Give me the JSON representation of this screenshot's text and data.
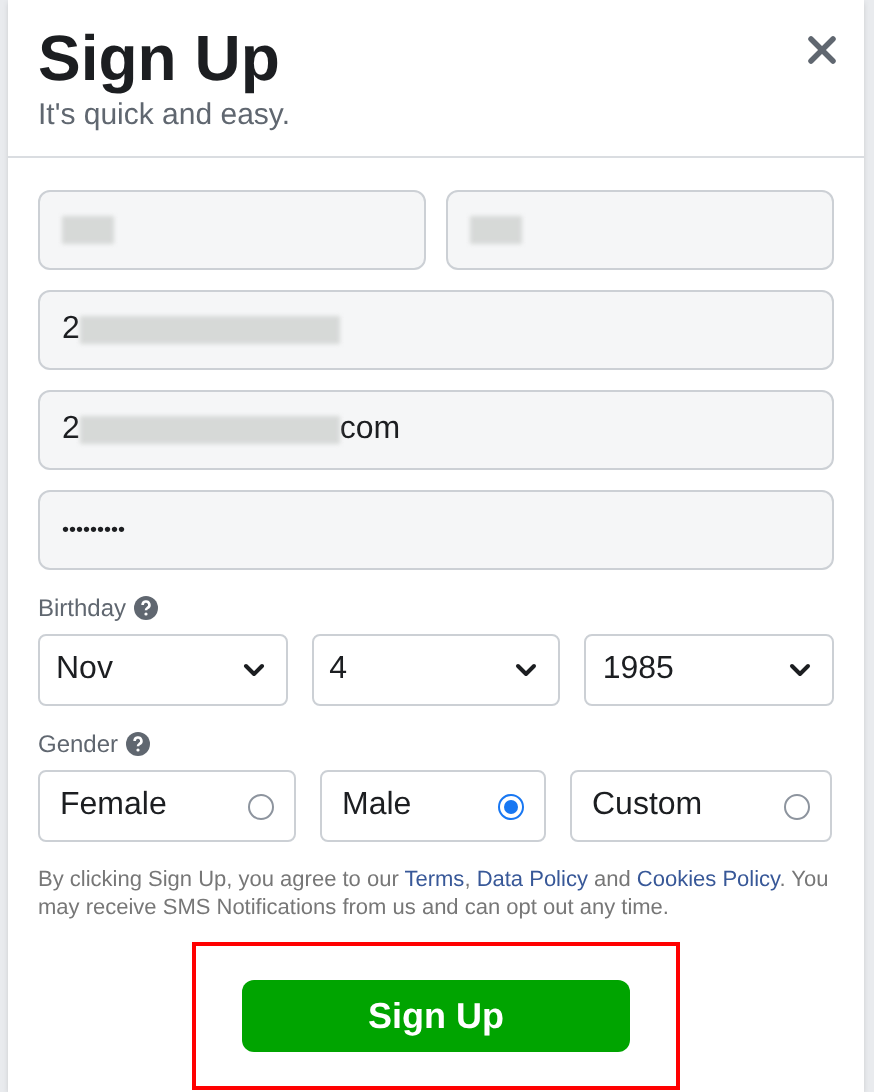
{
  "dialog": {
    "title": "Sign Up",
    "subtitle": "It's quick and easy."
  },
  "name_fields": [
    {
      "redacted": true
    },
    {
      "redacted": true
    }
  ],
  "contact_field": {
    "value": "2",
    "redacted": true
  },
  "email_field": {
    "value": "2",
    "value_end": "com",
    "redacted": true
  },
  "password_field": {
    "value": "•••••••••"
  },
  "birthday": {
    "label": "Birthday",
    "selects": [
      {
        "value": "Nov"
      },
      {
        "value": "4"
      },
      {
        "value": "1985"
      }
    ]
  },
  "gender": {
    "label": "Gender",
    "options": [
      {
        "label": "Female",
        "selected": false
      },
      {
        "label": "Male",
        "selected": true
      },
      {
        "label": "Custom",
        "selected": false
      }
    ]
  },
  "terms": [
    {
      "kind": "text",
      "text": "By clicking Sign Up, you agree to our "
    },
    {
      "kind": "link",
      "text": "Terms"
    },
    {
      "kind": "text",
      "text": ", "
    },
    {
      "kind": "link",
      "text": "Data Policy"
    },
    {
      "kind": "text",
      "text": " and "
    },
    {
      "kind": "link",
      "text": "Cookies Policy"
    },
    {
      "kind": "text",
      "text": ". You may receive SMS Notifications from us and can opt out any time."
    }
  ],
  "submit": {
    "label": "Sign Up",
    "highlighted": true
  }
}
